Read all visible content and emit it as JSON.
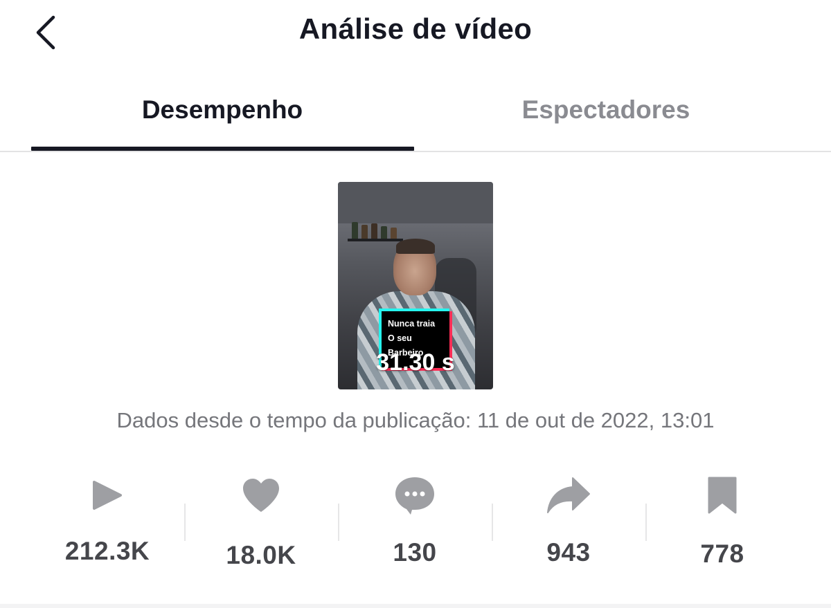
{
  "header": {
    "title": "Análise de vídeo",
    "back_icon": "chevron-left-icon"
  },
  "tabs": [
    {
      "label": "Desempenho",
      "active": true
    },
    {
      "label": "Espectadores",
      "active": false
    }
  ],
  "video": {
    "caption_lines": [
      "Nunca traia",
      "O seu",
      "Barbeiro"
    ],
    "duration": "31.30 s"
  },
  "publish_info": "Dados desde o tempo da publicação: 11 de out de 2022, 13:01",
  "stats": [
    {
      "icon": "play-icon",
      "value": "212.3K"
    },
    {
      "icon": "heart-icon",
      "value": "18.0K"
    },
    {
      "icon": "comment-icon",
      "value": "130"
    },
    {
      "icon": "share-icon",
      "value": "943"
    },
    {
      "icon": "bookmark-icon",
      "value": "778"
    }
  ],
  "colors": {
    "text_primary": "#161823",
    "text_secondary": "#8a8b91",
    "icon_gray": "#9e9fa3",
    "caption_cyan": "#25f4ee",
    "caption_red": "#fe2c55"
  }
}
